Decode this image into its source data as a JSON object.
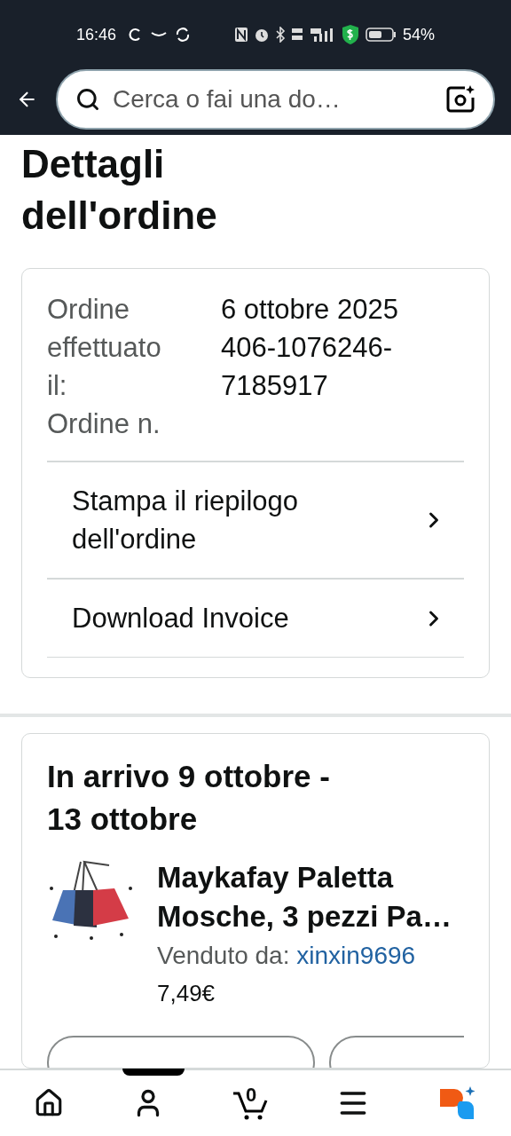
{
  "status_bar": {
    "time": "16:46",
    "battery": "54%"
  },
  "search": {
    "placeholder": "Cerca o fai una do…"
  },
  "title": "Dettagli dell'ordine",
  "order": {
    "labels": [
      "Ordine effettuato il:",
      "Ordine n."
    ],
    "date": "6 ottobre 2025",
    "number": "406-1076246-7185917"
  },
  "actions": [
    "Stampa il riepilogo dell'ordine",
    "Download Invoice"
  ],
  "shipment": {
    "heading": "In arrivo 9 ottobre - 13 ottobre",
    "product": {
      "kind": "picture",
      "name": "Maykafay Paletta Mosche, 3 pezzi Pa…",
      "seller_label": "Venduto da:",
      "seller": "xinxin9696",
      "price": "7,49€"
    }
  },
  "bottom_nav": {
    "cart_count": "0"
  }
}
